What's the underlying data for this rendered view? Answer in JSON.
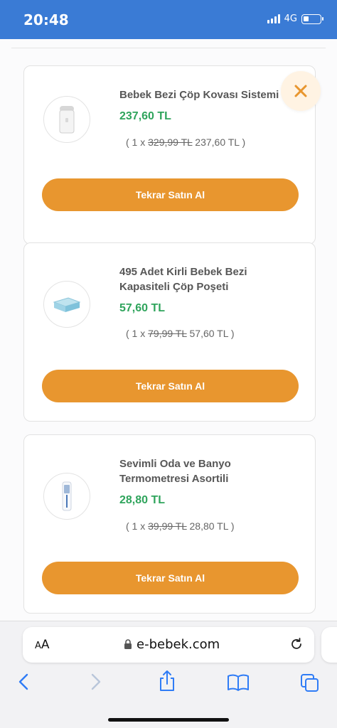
{
  "status": {
    "time": "20:48",
    "network": "4G"
  },
  "items": [
    {
      "name": "Bebek Bezi Çöp Kovası Sistemi",
      "price": "237,60 TL",
      "qty": "( 1 x ",
      "old_price": "329,99 TL",
      "new_price": " 237,60 TL )",
      "button": "Tekrar Satın Al",
      "thumb": "trash-can-product"
    },
    {
      "name": "495 Adet Kirli Bebek Bezi Kapasiteli Çöp Poşeti",
      "price": "57,60 TL",
      "qty": "( 1 x ",
      "old_price": "79,99 TL",
      "new_price": " 57,60 TL )",
      "button": "Tekrar Satın Al",
      "thumb": "bag-refill-product"
    },
    {
      "name": "Sevimli Oda ve Banyo Termometresi Asortili",
      "price": "28,80 TL",
      "qty": "( 1 x ",
      "old_price": "39,99 TL",
      "new_price": " 28,80 TL )",
      "button": "Tekrar Satın Al",
      "thumb": "thermometer-product"
    }
  ],
  "browser": {
    "aa": "AA",
    "url": "e-bebek.com"
  },
  "colors": {
    "accent": "#e8962f",
    "price": "#2fa45c",
    "status_bar": "#3a7bd5",
    "ios_blue": "#2f7cf6"
  }
}
